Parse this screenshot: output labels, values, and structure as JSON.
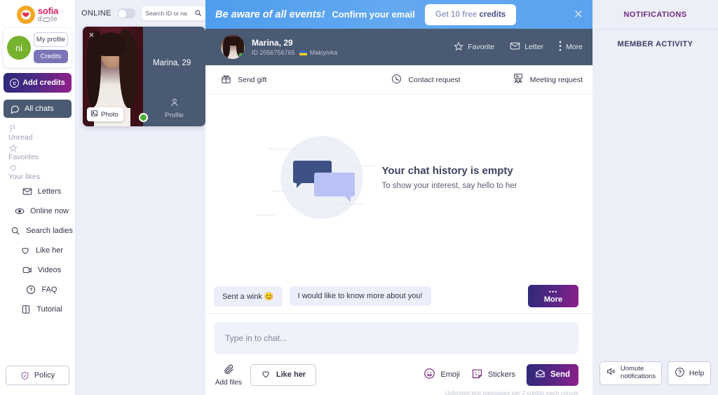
{
  "brand": {
    "name": "sofia",
    "sub": "date"
  },
  "account": {
    "avatar_initials": "ni",
    "my_profile_label": "My profile",
    "credits_label": "Credits",
    "add_credits_label": "Add credits"
  },
  "sidebar": {
    "active_item": "All chats",
    "items": [
      {
        "label": "All chats",
        "icon": "chat-icon",
        "active": true,
        "muted": false
      },
      {
        "label": "Unread",
        "icon": "flag-icon",
        "active": false,
        "muted": true
      },
      {
        "label": "Favorites",
        "icon": "star-icon",
        "active": false,
        "muted": true
      },
      {
        "label": "Your likes",
        "icon": "heart-icon",
        "active": false,
        "muted": true
      },
      {
        "label": "Letters",
        "icon": "envelope-icon",
        "active": false,
        "muted": false
      },
      {
        "label": "Online now",
        "icon": "online-dot-icon",
        "active": false,
        "muted": false
      },
      {
        "label": "Search ladies",
        "icon": "search-icon",
        "active": false,
        "muted": false
      },
      {
        "label": "Like her",
        "icon": "heart-outline-icon",
        "active": false,
        "muted": false
      },
      {
        "label": "Videos",
        "icon": "video-icon",
        "active": false,
        "muted": false
      },
      {
        "label": "FAQ",
        "icon": "question-icon",
        "active": false,
        "muted": false
      },
      {
        "label": "Tutorial",
        "icon": "book-icon",
        "active": false,
        "muted": false
      }
    ],
    "policy_label": "Policy"
  },
  "list_topbar": {
    "online_label": "ONLINE",
    "online_toggle_on": false,
    "search_placeholder": "Search ID or na"
  },
  "conversation_card": {
    "name_age": "Marina, 29",
    "photo_tab_label": "Photo",
    "profile_tab_label": "Profile",
    "is_online": true
  },
  "banner": {
    "headline": "Be aware of all events!",
    "subline": "Confirm your email",
    "cta_lead": "Get 10 free",
    "cta_bold": "credits",
    "close_label": "×",
    "bg_color": "#5ba3ee",
    "watermark": "70%"
  },
  "peer": {
    "name_age": "Marina, 29",
    "id_label": "ID 2056756765",
    "city": "Makiyivka",
    "actions": [
      {
        "label": "Favorite",
        "icon": "star-icon"
      },
      {
        "label": "Letter",
        "icon": "envelope-icon"
      },
      {
        "label": "More",
        "icon": "kebab-icon"
      }
    ]
  },
  "requests": [
    {
      "label": "Send gift",
      "icon": "gift-icon"
    },
    {
      "label": "Contact request",
      "icon": "phone-icon"
    },
    {
      "label": "Meeting request",
      "icon": "meeting-icon"
    }
  ],
  "empty_state": {
    "title": "Your chat history is empty",
    "subtitle": "To show your interest, say hello to her"
  },
  "quick_replies": {
    "chips": [
      "Sent a wink 😊",
      "I would like to know more about you!"
    ],
    "more_dots": "•••",
    "more_label": "More"
  },
  "composer": {
    "placeholder": "Type in to chat...",
    "add_files_label": "Add files",
    "like_her_label": "Like her",
    "emoji_label": "Emoji",
    "stickers_label": "Stickers",
    "send_label": "Send",
    "fineprint": "Unlimited text messages per 2 credits each minute"
  },
  "right_panel": {
    "notifications_title": "NOTIFICATIONS",
    "member_activity_title": "MEMBER ACTIVITY",
    "unmute_line1": "Unmute",
    "unmute_line2": "notifications",
    "help_label": "Help"
  },
  "colors": {
    "accent_purple": "#5b2585",
    "accent_magenta": "#8f1f8a",
    "banner_blue": "#5ba3ee",
    "header_slate": "#4a5a72",
    "page_bg": "#eceef8",
    "online_green": "#4caf2f",
    "notifications_title": "#6f2c7d"
  }
}
